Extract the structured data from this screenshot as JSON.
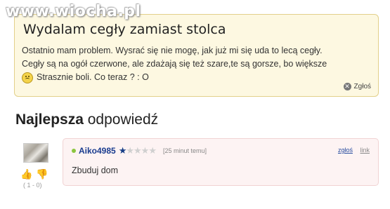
{
  "watermark": "www.wiocha.pl",
  "question": {
    "title": "Wydalam cegły zamiast stolca",
    "line1": "Ostatnio mam problem. Wysrać się nie mogę, jak już mi się uda to lecą cegły.",
    "line2": "Cegły są na ogół czerwone, ale zdażają się też szare,te są gorsze, bo większe",
    "line3": "Strasznie boli. Co teraz ? : O",
    "report_label": "Zgłoś"
  },
  "best_answer": {
    "heading_bold": "Najlepsza",
    "heading_rest": " odpowiedź",
    "username": "Aiko4985",
    "rating": {
      "value": 1,
      "max": 5
    },
    "time": "[25 minut temu]",
    "report_label": "zgłoś",
    "link_label": "link",
    "text": "Zbuduj dom",
    "votes": "( 1 - 0)"
  },
  "colors": {
    "question_bg": "#fdf8e1",
    "answer_bg": "#fdf3f3",
    "username": "#1a3c8f"
  }
}
